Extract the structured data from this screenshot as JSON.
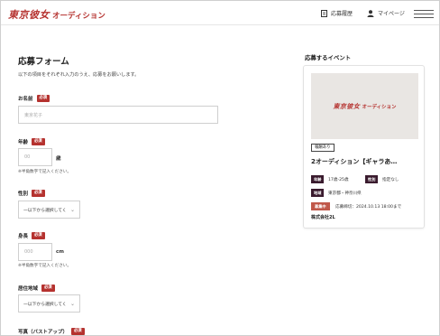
{
  "header": {
    "logo_main": "東京彼女",
    "logo_sub": "オーディション",
    "history_label": "応募履歴",
    "mypage_label": "マイページ"
  },
  "form": {
    "title": "応募フォーム",
    "lead": "以下の項目をそれぞれ入力のうえ、応募をお願いします。",
    "required_label": "必須",
    "name": {
      "label": "お名前",
      "placeholder": "東京花子"
    },
    "age": {
      "label": "年齢",
      "placeholder": "00",
      "unit": "歳",
      "note": "※半角数字で記入ください。"
    },
    "gender": {
      "label": "性別",
      "select_value": "—以下から選択してく",
      "chevron": "chevron-down-icon"
    },
    "height": {
      "label": "身長",
      "placeholder": "000",
      "unit": "cm",
      "note": "※半角数字で記入ください。"
    },
    "region": {
      "label": "居住地域",
      "select_value": "—以下から選択してく",
      "chevron": "chevron-down-icon"
    },
    "photo": {
      "label": "写真（バストアップ）"
    }
  },
  "sidebar": {
    "title": "応募するイベント",
    "event": {
      "image_logo_main": "東京彼女",
      "image_logo_sub": "オーディション",
      "badge": "報酬あり",
      "title": "2オーディション【ギャラあ…",
      "age_tag": "年齢",
      "age_value": "17歳-25歳",
      "gender_tag": "性別",
      "gender_value": "指定なし",
      "region_tag": "地域",
      "region_value": "東京都・神奈川県",
      "status_tag": "募集中",
      "deadline": "応募締切：2024.10.13 18:00まで",
      "company": "株式会社2L"
    }
  },
  "colors": {
    "brand_red": "#b5322f",
    "tag_dark": "#3a1b2e",
    "status_red": "#c0584a"
  }
}
